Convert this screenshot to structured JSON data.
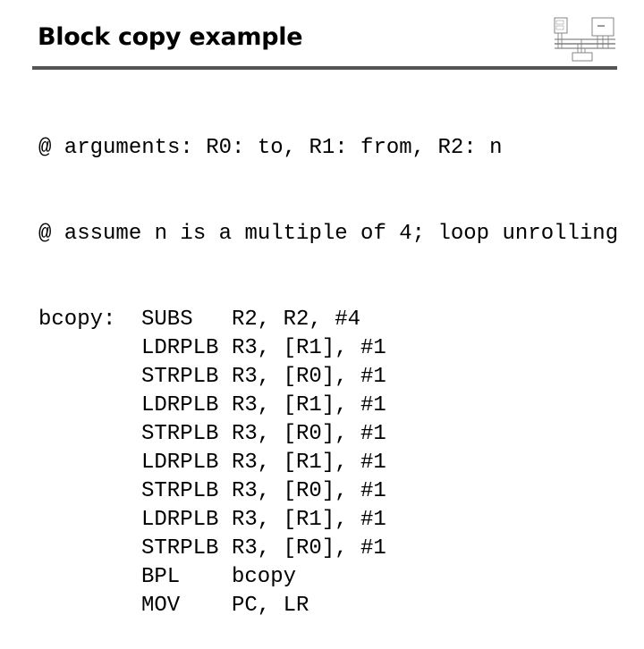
{
  "slide": {
    "title": "Block copy example",
    "diagram": {
      "icon": "system-block-diagram-icon",
      "blocks": [
        "Processor",
        "Memory",
        "I/O"
      ],
      "buses": [
        "address bus",
        "data bus",
        "control bus"
      ]
    }
  },
  "code": {
    "comments": [
      "@ arguments: R0: to, R1: from, R2: n",
      "@ assume n is a multiple of 4; loop unrolling"
    ],
    "instructions": [
      {
        "label": "bcopy:",
        "op": "SUBS",
        "args": "R2, R2, #4"
      },
      {
        "label": "",
        "op": "LDRPLB",
        "args": "R3, [R1], #1"
      },
      {
        "label": "",
        "op": "STRPLB",
        "args": "R3, [R0], #1"
      },
      {
        "label": "",
        "op": "LDRPLB",
        "args": "R3, [R1], #1"
      },
      {
        "label": "",
        "op": "STRPLB",
        "args": "R3, [R0], #1"
      },
      {
        "label": "",
        "op": "LDRPLB",
        "args": "R3, [R1], #1"
      },
      {
        "label": "",
        "op": "STRPLB",
        "args": "R3, [R0], #1"
      },
      {
        "label": "",
        "op": "LDRPLB",
        "args": "R3, [R1], #1"
      },
      {
        "label": "",
        "op": "STRPLB",
        "args": "R3, [R0], #1"
      },
      {
        "label": "",
        "op": "BPL",
        "args": "bcopy"
      },
      {
        "label": "",
        "op": "MOV",
        "args": "PC, LR"
      }
    ]
  }
}
